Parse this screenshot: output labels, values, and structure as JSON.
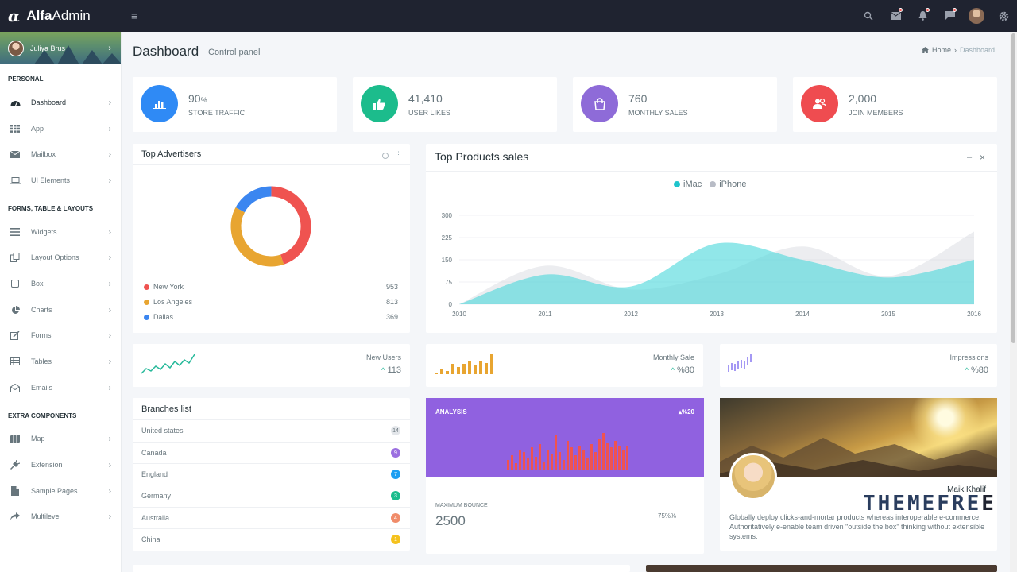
{
  "brand": {
    "logo_glyph": "α",
    "name_bold": "Alfa",
    "name_light": "Admin"
  },
  "topbar": {
    "icons": [
      "search-icon",
      "mail-icon",
      "bell-icon",
      "chat-icon",
      "avatar",
      "gear-icon"
    ]
  },
  "sidebar": {
    "user_name": "Juliya Brus",
    "sections": [
      "PERSONAL",
      "FORMS, TABLE & LAYOUTS",
      "EXTRA COMPONENTS"
    ],
    "items": [
      {
        "label": "Dashboard",
        "icon": "dashboard-icon"
      },
      {
        "label": "App",
        "icon": "grid-icon"
      },
      {
        "label": "Mailbox",
        "icon": "mail-icon"
      },
      {
        "label": "UI Elements",
        "icon": "laptop-icon"
      },
      {
        "label": "Widgets",
        "icon": "bars-icon"
      },
      {
        "label": "Layout Options",
        "icon": "copy-icon"
      },
      {
        "label": "Box",
        "icon": "square-icon"
      },
      {
        "label": "Charts",
        "icon": "pie-icon"
      },
      {
        "label": "Forms",
        "icon": "edit-icon"
      },
      {
        "label": "Tables",
        "icon": "table-icon"
      },
      {
        "label": "Emails",
        "icon": "envelope-open-icon"
      },
      {
        "label": "Map",
        "icon": "map-icon"
      },
      {
        "label": "Extension",
        "icon": "plug-icon"
      },
      {
        "label": "Sample Pages",
        "icon": "file-icon"
      },
      {
        "label": "Multilevel",
        "icon": "share-icon"
      }
    ]
  },
  "header": {
    "title": "Dashboard",
    "subtitle": "Control panel",
    "breadcrumb_home": "Home",
    "breadcrumb_current": "Dashboard",
    "breadcrumb_sep": "›"
  },
  "stats": [
    {
      "value": "90",
      "unit": "%",
      "label": "STORE TRAFFIC",
      "color": "#2f8af5",
      "icon": "bar-chart-icon"
    },
    {
      "value": "41,410",
      "unit": "",
      "label": "USER LIKES",
      "color": "#1cbc8c",
      "icon": "thumbs-up-icon"
    },
    {
      "value": "760",
      "unit": "",
      "label": "MONTHLY SALES",
      "color": "#8e6bd8",
      "icon": "shopping-bag-icon"
    },
    {
      "value": "2,000",
      "unit": "",
      "label": "JOIN MEMBERS",
      "color": "#ef4c50",
      "icon": "users-icon"
    }
  ],
  "advertisers": {
    "title": "Top Advertisers",
    "items": [
      {
        "name": "New York",
        "value": "953",
        "color": "#ef5350"
      },
      {
        "name": "Los Angeles",
        "value": "813",
        "color": "#e8a531"
      },
      {
        "name": "Dallas",
        "value": "369",
        "color": "#3b86f0"
      }
    ]
  },
  "sales_card": {
    "title": "Top Products sales",
    "minimize": "–",
    "close": "×"
  },
  "chart_data": {
    "type": "area",
    "title": "Top Products sales",
    "categories": [
      "2010",
      "2011",
      "2012",
      "2013",
      "2014",
      "2015",
      "2016"
    ],
    "series": [
      {
        "name": "iMac",
        "color": "#4dd8dc",
        "values": [
          0,
          100,
          60,
          205,
          150,
          90,
          150
        ]
      },
      {
        "name": "iPhone",
        "color": "#c8ccd4",
        "values": [
          0,
          130,
          50,
          100,
          195,
          95,
          245
        ]
      }
    ],
    "yticks": [
      "0",
      "75",
      "150",
      "225",
      "300"
    ],
    "ylim": [
      0,
      300
    ],
    "legend": "top-center"
  },
  "mini_stats": [
    {
      "label": "New Users",
      "value": "113",
      "arrow": "^",
      "color": "#26b99a"
    },
    {
      "label": "Monthly Sale",
      "value": "%80",
      "arrow": "^",
      "color": "#e8a531"
    },
    {
      "label": "Impressions",
      "value": "%80",
      "arrow": "^",
      "color": "#7460ee"
    }
  ],
  "branches": {
    "title": "Branches list",
    "items": [
      {
        "name": "United states",
        "count": "14",
        "color": "#e3e6ea"
      },
      {
        "name": "Canada",
        "count": "9",
        "color": "#9b6fe0"
      },
      {
        "name": "England",
        "count": "7",
        "color": "#1e9ff2"
      },
      {
        "name": "Germany",
        "count": "3",
        "color": "#1cbc8c"
      },
      {
        "name": "Australia",
        "count": "4",
        "color": "#f08c6a"
      },
      {
        "name": "China",
        "count": "1",
        "color": "#f5c21d"
      }
    ]
  },
  "analysis": {
    "label": "ANALYSIS",
    "change": "▴%20",
    "bounce_label": "MAXIMUM BOUNCE",
    "bounce_value": "2500",
    "percent": "75%%"
  },
  "profile": {
    "name": "Maik Khalif",
    "text": "Globally deploy clicks-and-mortar products whereas interoperable e-commerce. Authoritatively e-enable team driven \"outside the box\" thinking without extensible systems.",
    "watermark": "THEMEFRE",
    "watermark_tail": "E"
  }
}
